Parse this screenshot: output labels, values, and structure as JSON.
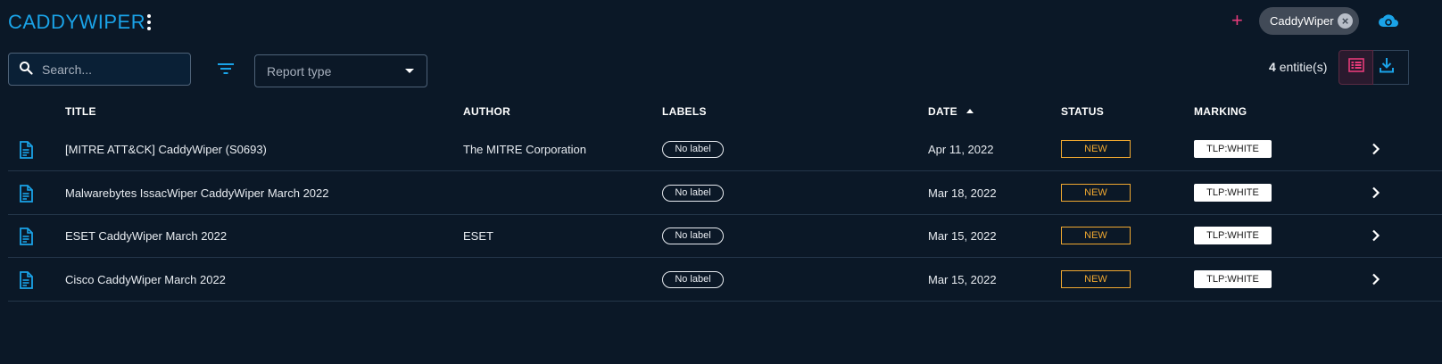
{
  "header": {
    "title": "CADDYWIPER",
    "add_icon": "plus-icon",
    "filter_chip": {
      "label": "CaddyWiper",
      "remove_icon": "close-circle-icon"
    },
    "cloud_icon": "cloud-refresh-icon"
  },
  "toolbar": {
    "search_placeholder": "Search...",
    "search_value": "",
    "filter_icon": "filter-list-icon",
    "report_type_placeholder": "Report type",
    "entity_count": "4",
    "entity_count_suffix": "entitie(s)",
    "view_list_icon": "list-view-icon",
    "export_icon": "download-icon"
  },
  "table": {
    "headers": {
      "title": "TITLE",
      "author": "AUTHOR",
      "labels": "LABELS",
      "date": "DATE",
      "status": "STATUS",
      "marking": "MARKING"
    },
    "sort": {
      "column": "date",
      "direction": "asc"
    },
    "rows": [
      {
        "title": "[MITRE ATT&CK] CaddyWiper (S0693)",
        "author": "The MITRE Corporation",
        "label": "No label",
        "date": "Apr 11, 2022",
        "status": "NEW",
        "marking": "TLP:WHITE"
      },
      {
        "title": "Malwarebytes IssacWiper CaddyWiper March 2022",
        "author": "",
        "label": "No label",
        "date": "Mar 18, 2022",
        "status": "NEW",
        "marking": "TLP:WHITE"
      },
      {
        "title": "ESET CaddyWiper March 2022",
        "author": "ESET",
        "label": "No label",
        "date": "Mar 15, 2022",
        "status": "NEW",
        "marking": "TLP:WHITE"
      },
      {
        "title": "Cisco CaddyWiper March 2022",
        "author": "",
        "label": "No label",
        "date": "Mar 15, 2022",
        "status": "NEW",
        "marking": "TLP:WHITE"
      }
    ]
  },
  "colors": {
    "background": "#0b1827",
    "accent_blue": "#1aa3e8",
    "accent_pink": "#e63b7a",
    "status_orange": "#f0a830"
  }
}
